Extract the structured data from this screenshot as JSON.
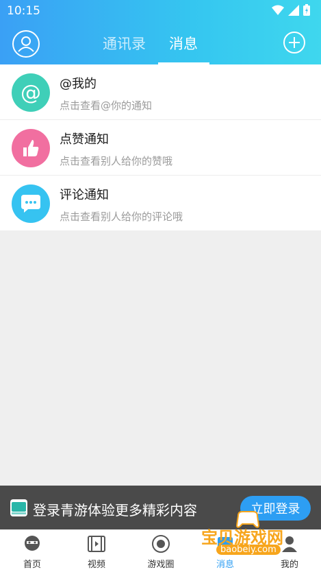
{
  "status": {
    "time": "10:15"
  },
  "header": {
    "tabs": [
      {
        "label": "通讯录",
        "active": false
      },
      {
        "label": "消息",
        "active": true
      }
    ]
  },
  "messages": [
    {
      "title": "@我的",
      "subtitle": "点击查看@你的通知",
      "icon": "at-icon",
      "color": "#3fcfb8"
    },
    {
      "title": "点赞通知",
      "subtitle": "点击查看别人给你的赞哦",
      "icon": "thumbs-up-icon",
      "color": "#f16fa0"
    },
    {
      "title": "评论通知",
      "subtitle": "点击查看别人给你的评论哦",
      "icon": "chat-bubble-icon",
      "color": "#36c3f1"
    }
  ],
  "login_banner": {
    "text": "登录青游体验更多精彩内容",
    "button": "立即登录"
  },
  "nav": [
    {
      "label": "首页",
      "icon": "home-icon"
    },
    {
      "label": "视频",
      "icon": "film-icon"
    },
    {
      "label": "游戏圈",
      "icon": "game-circle-icon"
    },
    {
      "label": "消息",
      "icon": "message-icon",
      "active": true
    },
    {
      "label": "我的",
      "icon": "profile-icon"
    }
  ],
  "watermark": {
    "text": "宝贝游戏网",
    "url": "baobeiy.com"
  },
  "colors": {
    "accent": "#2d9ef3",
    "header_start": "#3aa0f5",
    "header_end": "#3fd7ee"
  }
}
